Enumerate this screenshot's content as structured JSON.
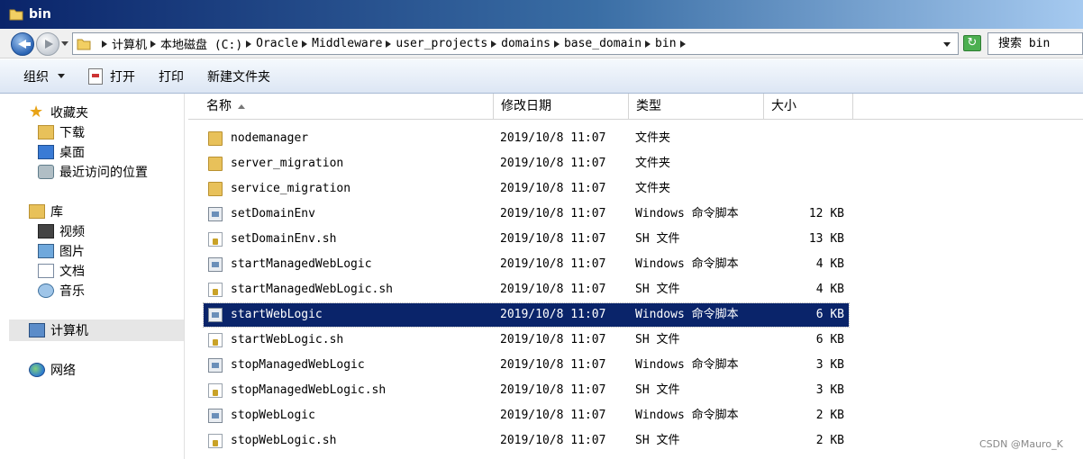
{
  "window": {
    "title": "bin"
  },
  "address": {
    "crumbs": [
      "计算机",
      "本地磁盘 (C:)",
      "Oracle",
      "Middleware",
      "user_projects",
      "domains",
      "base_domain",
      "bin"
    ]
  },
  "search": {
    "placeholder": "搜索 bin"
  },
  "toolbar": {
    "organize": "组织",
    "open": "打开",
    "print": "打印",
    "new_folder": "新建文件夹"
  },
  "sidebar": {
    "favorites": "收藏夹",
    "downloads": "下载",
    "desktop": "桌面",
    "recent": "最近访问的位置",
    "libraries": "库",
    "videos": "视频",
    "pictures": "图片",
    "documents": "文档",
    "music": "音乐",
    "computer": "计算机",
    "network": "网络"
  },
  "columns": {
    "name": "名称",
    "date": "修改日期",
    "type": "类型",
    "size": "大小"
  },
  "files": [
    {
      "name": "nodemanager",
      "date": "2019/10/8 11:07",
      "type": "文件夹",
      "size": "",
      "icon": "folder-icon"
    },
    {
      "name": "server_migration",
      "date": "2019/10/8 11:07",
      "type": "文件夹",
      "size": "",
      "icon": "folder-icon"
    },
    {
      "name": "service_migration",
      "date": "2019/10/8 11:07",
      "type": "文件夹",
      "size": "",
      "icon": "folder-icon"
    },
    {
      "name": "setDomainEnv",
      "date": "2019/10/8 11:07",
      "type": "Windows 命令脚本",
      "size": "12 KB",
      "icon": "cmd-script-icon"
    },
    {
      "name": "setDomainEnv.sh",
      "date": "2019/10/8 11:07",
      "type": "SH 文件",
      "size": "13 KB",
      "icon": "sh-file-icon"
    },
    {
      "name": "startManagedWebLogic",
      "date": "2019/10/8 11:07",
      "type": "Windows 命令脚本",
      "size": "4 KB",
      "icon": "cmd-script-icon"
    },
    {
      "name": "startManagedWebLogic.sh",
      "date": "2019/10/8 11:07",
      "type": "SH 文件",
      "size": "4 KB",
      "icon": "sh-file-icon"
    },
    {
      "name": "startWebLogic",
      "date": "2019/10/8 11:07",
      "type": "Windows 命令脚本",
      "size": "6 KB",
      "icon": "cmd-script-icon",
      "selected": true
    },
    {
      "name": "startWebLogic.sh",
      "date": "2019/10/8 11:07",
      "type": "SH 文件",
      "size": "6 KB",
      "icon": "sh-file-icon"
    },
    {
      "name": "stopManagedWebLogic",
      "date": "2019/10/8 11:07",
      "type": "Windows 命令脚本",
      "size": "3 KB",
      "icon": "cmd-script-icon"
    },
    {
      "name": "stopManagedWebLogic.sh",
      "date": "2019/10/8 11:07",
      "type": "SH 文件",
      "size": "3 KB",
      "icon": "sh-file-icon"
    },
    {
      "name": "stopWebLogic",
      "date": "2019/10/8 11:07",
      "type": "Windows 命令脚本",
      "size": "2 KB",
      "icon": "cmd-script-icon"
    },
    {
      "name": "stopWebLogic.sh",
      "date": "2019/10/8 11:07",
      "type": "SH 文件",
      "size": "2 KB",
      "icon": "sh-file-icon"
    }
  ],
  "watermark": "CSDN @Mauro_K"
}
